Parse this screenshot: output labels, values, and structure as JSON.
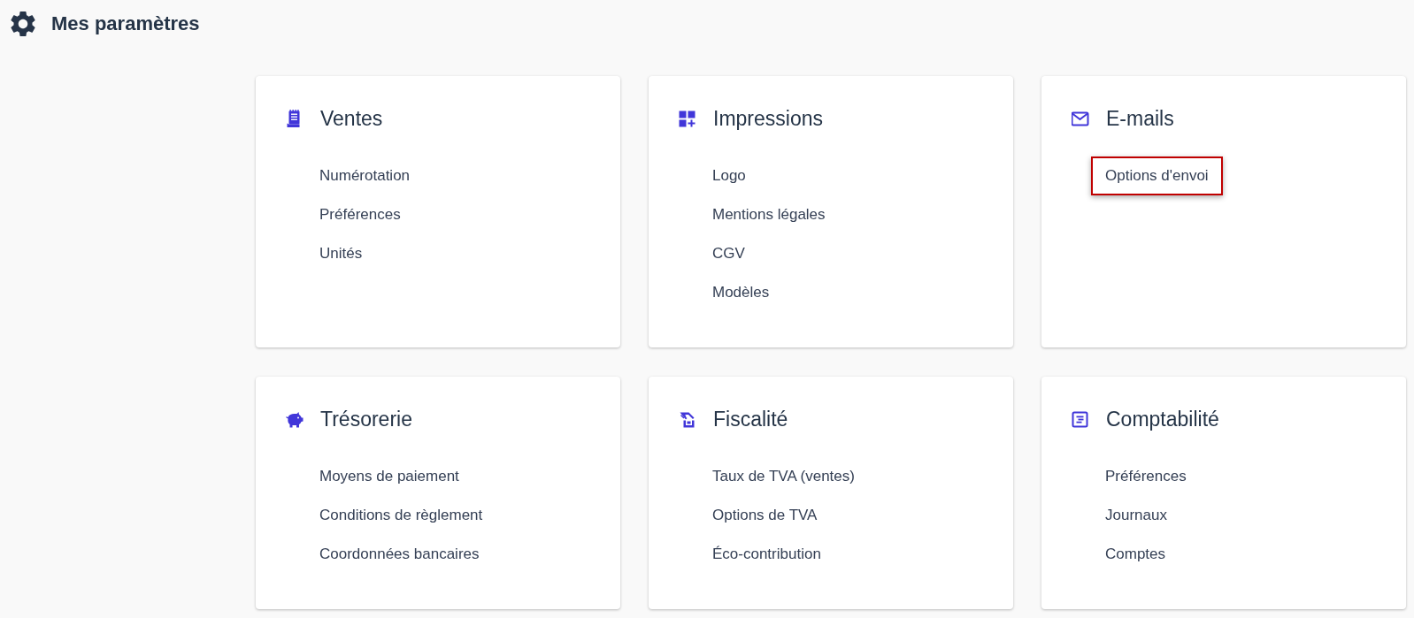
{
  "page": {
    "title": "Mes paramètres"
  },
  "sections": [
    {
      "title": "Ventes",
      "links": [
        {
          "label": "Numérotation",
          "highlighted": false
        },
        {
          "label": "Préférences",
          "highlighted": false
        },
        {
          "label": "Unités",
          "highlighted": false
        }
      ]
    },
    {
      "title": "Impressions",
      "links": [
        {
          "label": "Logo",
          "highlighted": false
        },
        {
          "label": "Mentions légales",
          "highlighted": false
        },
        {
          "label": "CGV",
          "highlighted": false
        },
        {
          "label": "Modèles",
          "highlighted": false
        }
      ]
    },
    {
      "title": "E-mails",
      "links": [
        {
          "label": "Options d'envoi",
          "highlighted": true
        }
      ]
    },
    {
      "title": "Trésorerie",
      "links": [
        {
          "label": "Moyens de paiement",
          "highlighted": false
        },
        {
          "label": "Conditions de règlement",
          "highlighted": false
        },
        {
          "label": "Coordonnées bancaires",
          "highlighted": false
        }
      ]
    },
    {
      "title": "Fiscalité",
      "links": [
        {
          "label": "Taux de TVA (ventes)",
          "highlighted": false
        },
        {
          "label": "Options de TVA",
          "highlighted": false
        },
        {
          "label": "Éco-contribution",
          "highlighted": false
        }
      ]
    },
    {
      "title": "Comptabilité",
      "links": [
        {
          "label": "Préférences",
          "highlighted": false
        },
        {
          "label": "Journaux",
          "highlighted": false
        },
        {
          "label": "Comptes",
          "highlighted": false
        }
      ]
    }
  ]
}
